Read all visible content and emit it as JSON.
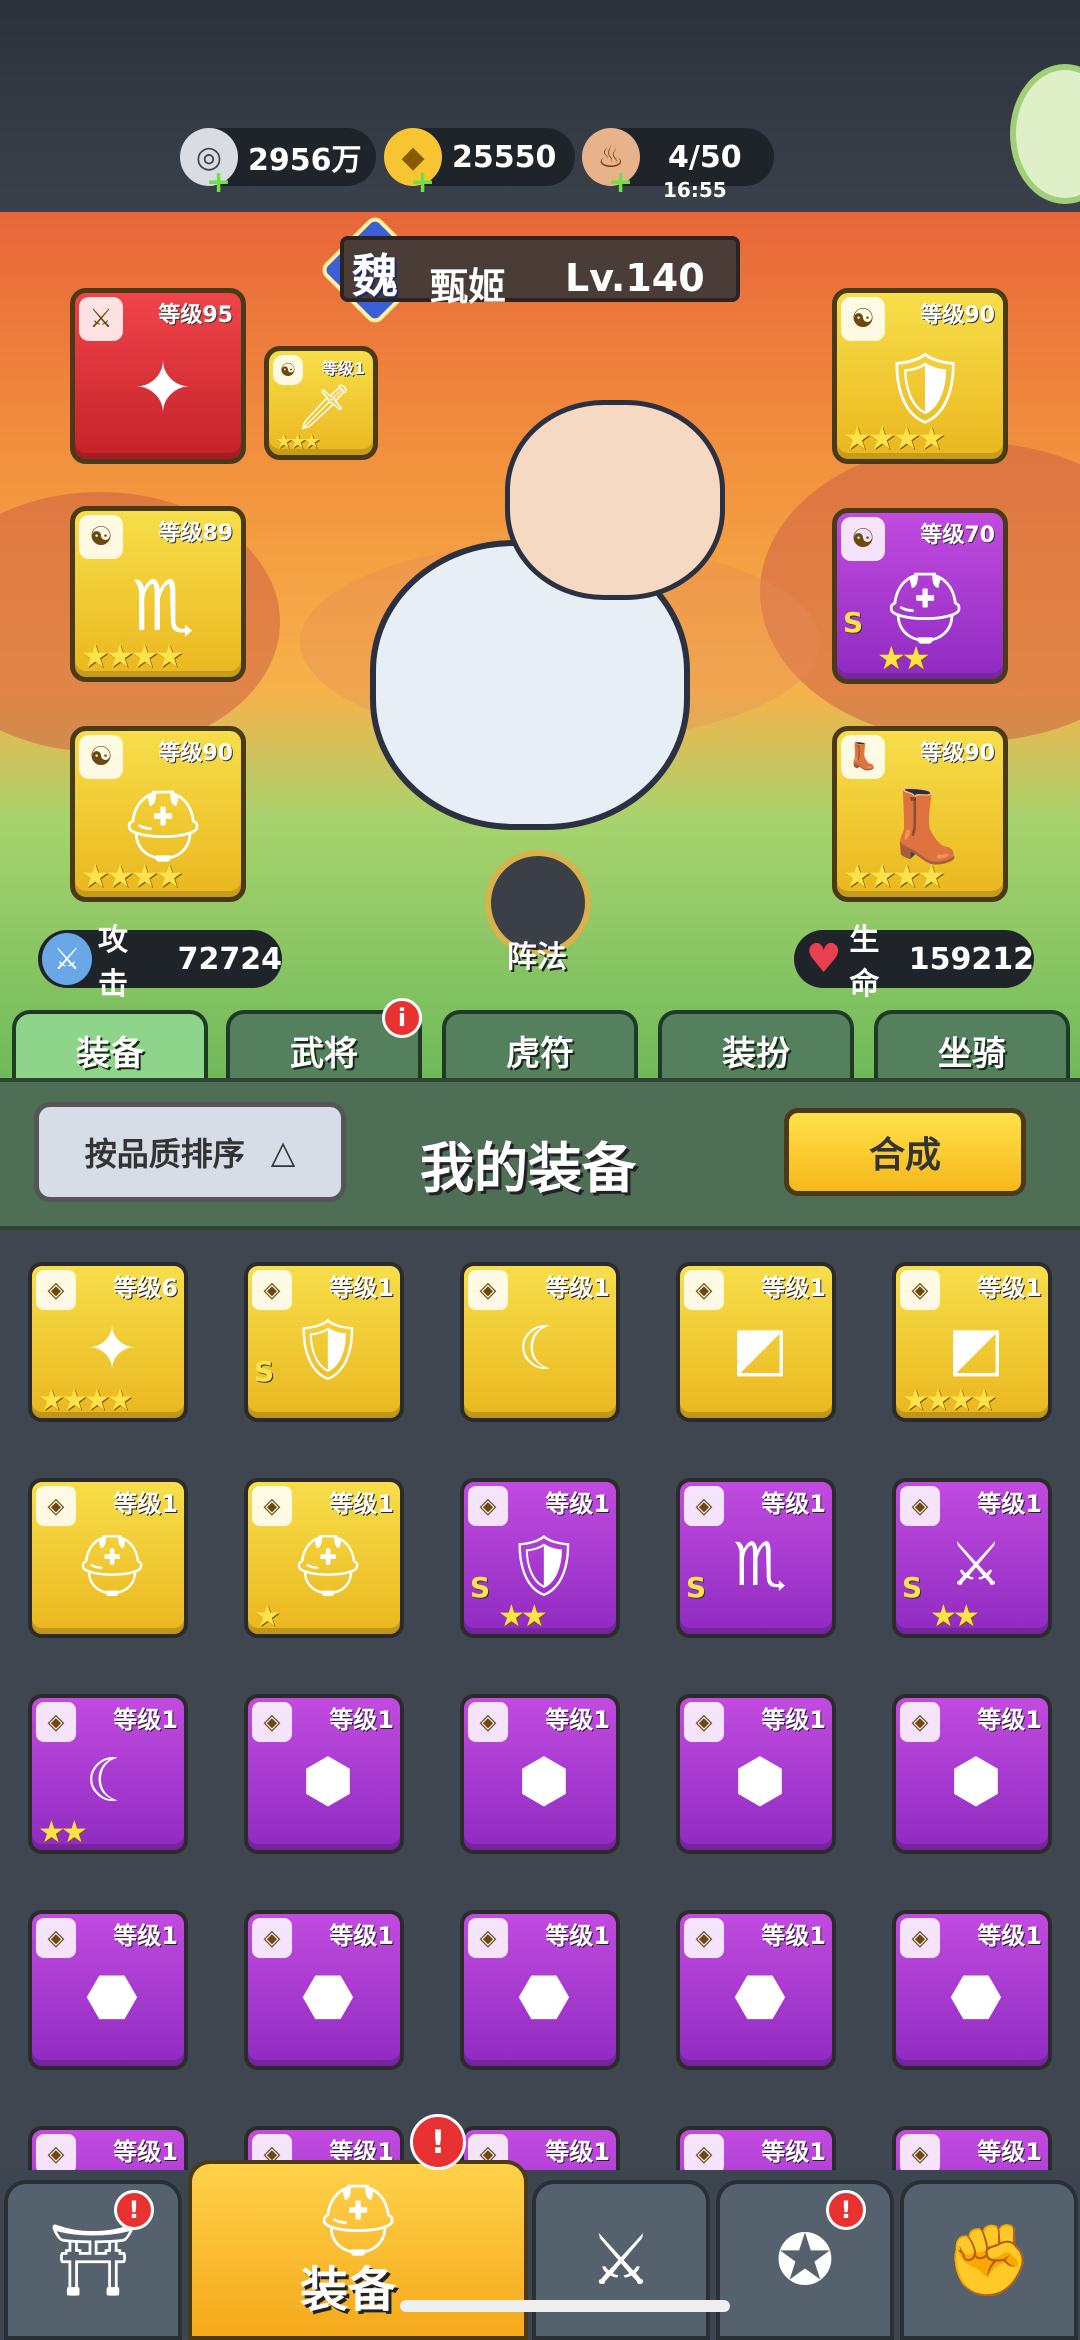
{
  "resources": [
    {
      "icon": "silver-coin-icon",
      "value": "2956万"
    },
    {
      "icon": "gold-ingot-icon",
      "value": "25550"
    },
    {
      "icon": "meat-icon",
      "value": "4/50",
      "timer": "16:55"
    }
  ],
  "hero": {
    "kingdom": "魏",
    "name": "甄姬",
    "level": "Lv.140",
    "attack_label": "攻击",
    "attack": "72724",
    "hp_label": "生命",
    "hp": "159212",
    "formation_label": "阵法"
  },
  "equipped": [
    {
      "level": "等级95",
      "rarity": "red",
      "icon": "shuriken-icon",
      "stars": ""
    },
    {
      "level": "等级1",
      "rarity": "gold",
      "icon": "blade-icon",
      "stars": "★★★"
    },
    {
      "level": "等级89",
      "rarity": "gold",
      "icon": "scorpion-amulet-icon",
      "stars": "★★★★"
    },
    {
      "level": "等级90",
      "rarity": "gold",
      "icon": "helmet-icon",
      "stars": "★★★★"
    },
    {
      "level": "等级90",
      "rarity": "gold",
      "icon": "armor-icon",
      "stars": "★★★★"
    },
    {
      "level": "等级70",
      "rarity": "purple",
      "icon": "helmet-icon",
      "stars": "★★",
      "grade": "S"
    },
    {
      "level": "等级90",
      "rarity": "gold",
      "icon": "boots-icon",
      "stars": "★★★★"
    }
  ],
  "tabs": [
    "装备",
    "武将",
    "虎符",
    "装扮",
    "坐骑"
  ],
  "tab_badge": "i",
  "panel": {
    "sort_label": "按品质排序",
    "sort_arrow": "△",
    "title": "我的装备",
    "synth_label": "合成"
  },
  "inventory": [
    {
      "level": "等级6",
      "rarity": "gold",
      "icon": "shuriken-icon",
      "stars": "★★★★"
    },
    {
      "level": "等级1",
      "rarity": "gold",
      "icon": "armor-icon",
      "stars": "",
      "grade": "S"
    },
    {
      "level": "等级1",
      "rarity": "gold",
      "icon": "scimitar-icon",
      "stars": ""
    },
    {
      "level": "等级1",
      "rarity": "gold",
      "icon": "bracer-icon",
      "stars": ""
    },
    {
      "level": "等级1",
      "rarity": "gold",
      "icon": "bracer-icon",
      "stars": "★★★★"
    },
    {
      "level": "等级1",
      "rarity": "gold",
      "icon": "helmet-icon",
      "stars": ""
    },
    {
      "level": "等级1",
      "rarity": "gold",
      "icon": "helmet-icon",
      "stars": "★"
    },
    {
      "level": "等级1",
      "rarity": "purple",
      "icon": "armor-icon",
      "stars": "★★",
      "grade": "S"
    },
    {
      "level": "等级1",
      "rarity": "purple",
      "icon": "scorpion-amulet-icon",
      "stars": "",
      "grade": "S"
    },
    {
      "level": "等级1",
      "rarity": "purple",
      "icon": "crystal-sword-icon",
      "stars": "★★",
      "grade": "S"
    },
    {
      "level": "等级1",
      "rarity": "purple",
      "icon": "scimitar-icon",
      "stars": "★★"
    },
    {
      "level": "等级1",
      "rarity": "purple",
      "icon": "pauldron-icon",
      "stars": ""
    },
    {
      "level": "等级1",
      "rarity": "purple",
      "icon": "pauldron-icon",
      "stars": ""
    },
    {
      "level": "等级1",
      "rarity": "purple",
      "icon": "pauldron-icon",
      "stars": ""
    },
    {
      "level": "等级1",
      "rarity": "purple",
      "icon": "pauldron-icon",
      "stars": ""
    },
    {
      "level": "等级1",
      "rarity": "purple",
      "icon": "chestplate-icon",
      "stars": ""
    },
    {
      "level": "等级1",
      "rarity": "purple",
      "icon": "chestplate-icon",
      "stars": ""
    },
    {
      "level": "等级1",
      "rarity": "purple",
      "icon": "chestplate-icon",
      "stars": ""
    },
    {
      "level": "等级1",
      "rarity": "purple",
      "icon": "chestplate-icon",
      "stars": ""
    },
    {
      "level": "等级1",
      "rarity": "purple",
      "icon": "chestplate-icon",
      "stars": ""
    },
    {
      "level": "等级1",
      "rarity": "purple",
      "icon": "armor-icon",
      "stars": ""
    },
    {
      "level": "等级1",
      "rarity": "purple",
      "icon": "armor-icon",
      "stars": ""
    },
    {
      "level": "等级1",
      "rarity": "purple",
      "icon": "armor-icon",
      "stars": ""
    },
    {
      "level": "等级1",
      "rarity": "purple",
      "icon": "amulet-icon",
      "stars": ""
    },
    {
      "level": "等级1",
      "rarity": "purple",
      "icon": "amulet-icon",
      "stars": ""
    }
  ],
  "bottom_nav": [
    {
      "name": "城池",
      "icon": "gate-icon",
      "badge": "!"
    },
    {
      "label": "装备",
      "icon": "knight-helmet-icon",
      "badge": "!"
    },
    {
      "name": "战斗",
      "icon": "crossed-swords-icon",
      "badge": ""
    },
    {
      "name": "英雄",
      "icon": "hero-icon",
      "badge": "!"
    },
    {
      "name": "升级",
      "icon": "fist-icon",
      "badge": ""
    }
  ],
  "colors": {
    "gold": "#eab71f",
    "purple": "#9b31c9",
    "red": "#d22a30",
    "accent": "#ffd24a"
  }
}
